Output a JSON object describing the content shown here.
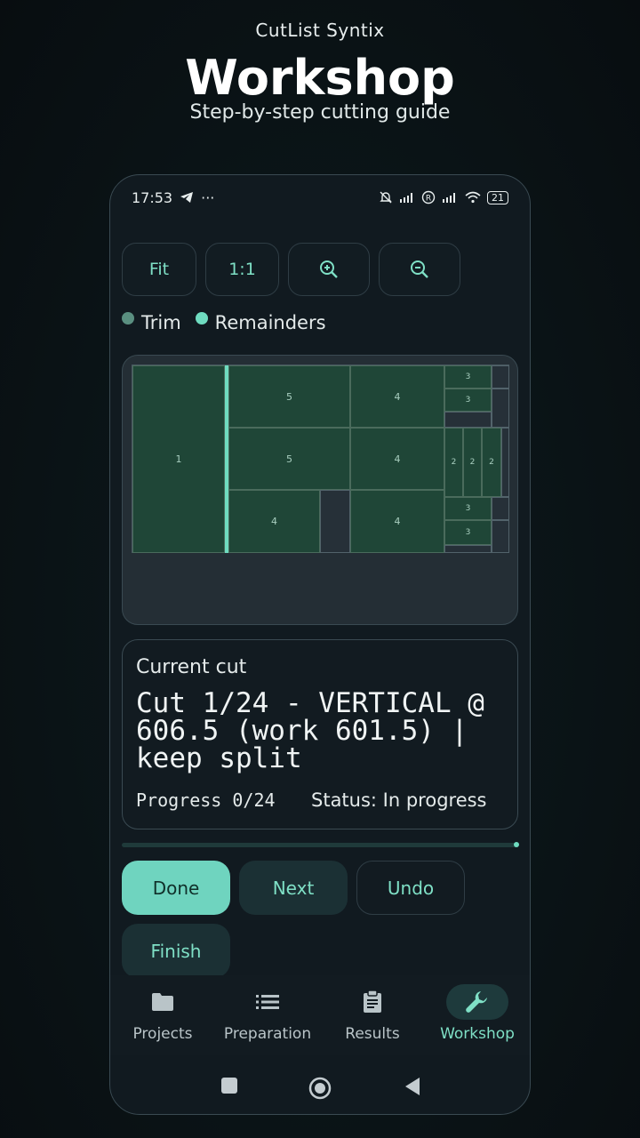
{
  "hero": {
    "app_name": "CutList Syntix",
    "title": "Workshop",
    "subtitle": "Step-by-step cutting guide"
  },
  "status_bar": {
    "time": "17:53",
    "battery": "21"
  },
  "toolbar": {
    "fit_label": "Fit",
    "one_to_one_label": "1:1",
    "zoom_in_icon": "zoom-in-icon",
    "zoom_out_icon": "zoom-out-icon"
  },
  "legend": {
    "trim_label": "Trim",
    "trim_color": "#5a8f80",
    "remainders_label": "Remainders",
    "remainders_color": "#6fdcc0"
  },
  "layout_pieces": {
    "p1": "1",
    "p5a": "5",
    "p5b": "5",
    "p4a": "4",
    "p4b": "4",
    "p4c": "4",
    "p4d": "4",
    "p3a": "3",
    "p3b": "3",
    "p3c": "3",
    "p3d": "3",
    "p2a": "2",
    "p2b": "2",
    "p2c": "2"
  },
  "current_cut": {
    "label": "Current cut",
    "instruction": "Cut 1/24 - VERTICAL @ 606.5 (work 601.5) | keep split",
    "progress": "Progress 0/24",
    "status": "Status: In progress",
    "progress_fraction": 0
  },
  "actions": {
    "done": "Done",
    "next": "Next",
    "undo": "Undo",
    "finish": "Finish"
  },
  "nav": {
    "projects": "Projects",
    "preparation": "Preparation",
    "results": "Results",
    "workshop": "Workshop",
    "active": "workshop"
  }
}
